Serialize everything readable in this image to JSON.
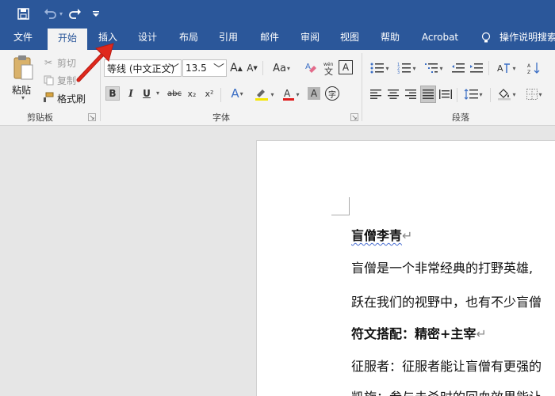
{
  "qat": {
    "save_icon": "save-icon",
    "undo_icon": "undo-icon",
    "redo_icon": "redo-icon",
    "customize_icon": "customize-icon"
  },
  "tabs": [
    {
      "label": "文件"
    },
    {
      "label": "开始"
    },
    {
      "label": "插入"
    },
    {
      "label": "设计"
    },
    {
      "label": "布局"
    },
    {
      "label": "引用"
    },
    {
      "label": "邮件"
    },
    {
      "label": "审阅"
    },
    {
      "label": "视图"
    },
    {
      "label": "帮助"
    },
    {
      "label": "Acrobat"
    },
    {
      "label": "操作说明搜索"
    }
  ],
  "clipboard": {
    "paste_label": "粘贴",
    "cut_label": "剪切",
    "copy_label": "复制",
    "format_painter_label": "格式刷",
    "group_label": "剪贴板"
  },
  "font": {
    "font_name": "等线 (中文正文)",
    "font_size": "13.5",
    "group_label": "字体",
    "bold": "B",
    "italic": "I",
    "underline": "U",
    "strike": "abc",
    "subscript": "x₂",
    "superscript": "x²",
    "grow": "A",
    "shrink": "A",
    "case": "Aa",
    "char_border": "A",
    "char_shading": "A",
    "enclose": "字"
  },
  "paragraph": {
    "group_label": "段落"
  },
  "document": {
    "lines": [
      "盲僧李青",
      "盲僧是一个非常经典的打野英雄,",
      "跃在我们的视野中，也有不少盲僧",
      "符文搭配：精密+主宰",
      "征服者：征服者能让盲僧有更强的",
      "凯旋：参与击杀时的回血效果能让"
    ]
  },
  "colors": {
    "ribbon_blue": "#2b579a",
    "ribbon_bg": "#f3f3f3",
    "workspace": "#e6e6e6",
    "arrow_red": "#e0281c"
  }
}
